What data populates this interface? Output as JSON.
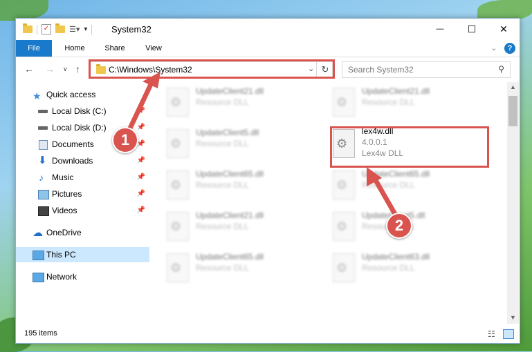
{
  "window": {
    "title": "System32",
    "controls": {
      "minimize": "—",
      "maximize": "☐",
      "close": "✕"
    }
  },
  "ribbon": {
    "tabs": [
      {
        "label": "File"
      },
      {
        "label": "Home"
      },
      {
        "label": "Share"
      },
      {
        "label": "View"
      }
    ],
    "expand_icon": "chevron-down-icon",
    "help_icon": "?"
  },
  "address": {
    "path": "C:\\Windows\\System32",
    "search_placeholder": "Search System32"
  },
  "nav_pane": {
    "items": [
      {
        "label": "Quick access",
        "icon": "star-icon",
        "pinned": false
      },
      {
        "label": "Local Disk (C:)",
        "icon": "drive-icon",
        "pinned": true
      },
      {
        "label": "Local Disk (D:)",
        "icon": "drive-icon",
        "pinned": true
      },
      {
        "label": "Documents",
        "icon": "documents-icon",
        "pinned": true
      },
      {
        "label": "Downloads",
        "icon": "download-icon",
        "pinned": true
      },
      {
        "label": "Music",
        "icon": "music-icon",
        "pinned": true
      },
      {
        "label": "Pictures",
        "icon": "pictures-icon",
        "pinned": true
      },
      {
        "label": "Videos",
        "icon": "videos-icon",
        "pinned": true
      },
      {
        "label": "OneDrive",
        "icon": "cloud-icon",
        "pinned": false
      },
      {
        "label": "This PC",
        "icon": "computer-icon",
        "pinned": false,
        "selected": true
      },
      {
        "label": "Network",
        "icon": "network-icon",
        "pinned": false
      }
    ]
  },
  "files": [
    {
      "name": "UpdateClient21.dll",
      "type": "Resource DLL",
      "blurred": true
    },
    {
      "name": "UpdateClient21.dll",
      "type": "Resource DLL",
      "blurred": true
    },
    {
      "name": "UpdateClient5.dll",
      "type": "Resource DLL",
      "blurred": true
    },
    {
      "name": "lex4w.dll",
      "version": "4.0.0.1",
      "type": "Lex4w DLL",
      "blurred": false,
      "highlighted": true
    },
    {
      "name": "UpdateClient65.dll",
      "type": "Resource DLL",
      "blurred": true
    },
    {
      "name": "UpdateClient65.dll",
      "type": "Resource DLL",
      "blurred": true
    },
    {
      "name": "UpdateClient21.dll",
      "type": "Resource DLL",
      "blurred": true
    },
    {
      "name": "UpdateClient5.dll",
      "type": "Resource DLL",
      "blurred": true
    },
    {
      "name": "UpdateClient65.dll",
      "type": "Resource DLL",
      "blurred": true
    },
    {
      "name": "UpdateClient63.dll",
      "type": "Resource DLL",
      "blurred": true
    }
  ],
  "status": {
    "item_count": "195 items"
  },
  "callouts": [
    "1",
    "2"
  ],
  "colors": {
    "accent": "#1979ca",
    "highlight": "#d9534f",
    "selected": "#cce8ff"
  }
}
